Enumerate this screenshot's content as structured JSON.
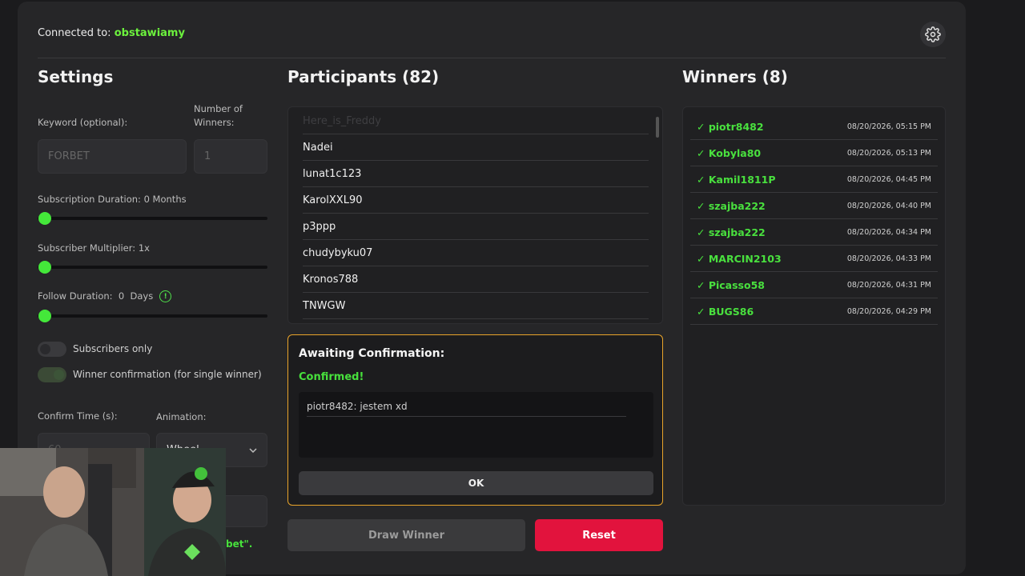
{
  "header": {
    "connected_label": "Connected to:",
    "channel": "obstawiamy",
    "settings_icon": "gear-icon"
  },
  "settings": {
    "title": "Settings",
    "keyword_label": "Keyword (optional):",
    "keyword_placeholder": "FORBET",
    "winners_label_1": "Number of",
    "winners_label_2": "Winners:",
    "winners_placeholder": "1",
    "subscription_label": "Subscription Duration: 0 Months",
    "subscription_value": 0,
    "multiplier_label": "Subscriber Multiplier: 1x",
    "multiplier_value": 1,
    "follow_label": "Follow Duration:  0  Days",
    "follow_value": 0,
    "subscribers_only_label": "Subscribers only",
    "subscribers_only": false,
    "winner_confirmation_label": "Winner confirmation (for single winner)",
    "winner_confirmation": true,
    "confirm_time_label": "Confirm Time (s):",
    "confirm_time_value": "60",
    "animation_label": "Animation:",
    "animation_value": "Wheel",
    "partial_text": "bet\"."
  },
  "participants": {
    "title": "Participants (82)",
    "items": [
      "Here_is_Freddy",
      "Nadei",
      "lunat1c123",
      "KarolXXL90",
      "p3ppp",
      "chudybyku07",
      "Kronos788",
      "TNWGW"
    ]
  },
  "confirmation": {
    "title": "Awaiting Confirmation:",
    "status": "Confirmed!",
    "message": "piotr8482: jestem xd",
    "ok_label": "OK"
  },
  "actions": {
    "draw_label": "Draw Winner",
    "reset_label": "Reset"
  },
  "winners": {
    "title": "Winners (8)",
    "items": [
      {
        "name": "✓ piotr8482",
        "date": "08/20/2026, 05:15 PM"
      },
      {
        "name": "✓ Kobyla80",
        "date": "08/20/2026, 05:13 PM"
      },
      {
        "name": "✓ Kamil1811P",
        "date": "08/20/2026, 04:45 PM"
      },
      {
        "name": "✓ szajba222",
        "date": "08/20/2026, 04:40 PM"
      },
      {
        "name": "✓ szajba222",
        "date": "08/20/2026, 04:34 PM"
      },
      {
        "name": "✓ MARCIN2103",
        "date": "08/20/2026, 04:33 PM"
      },
      {
        "name": "✓ Picasso58",
        "date": "08/20/2026, 04:31 PM"
      },
      {
        "name": "✓ BUGS86",
        "date": "08/20/2026, 04:29 PM"
      }
    ]
  },
  "colors": {
    "accent_green": "#47e03c",
    "reset_red": "#e2133d",
    "confirm_border": "#e9a42a"
  }
}
